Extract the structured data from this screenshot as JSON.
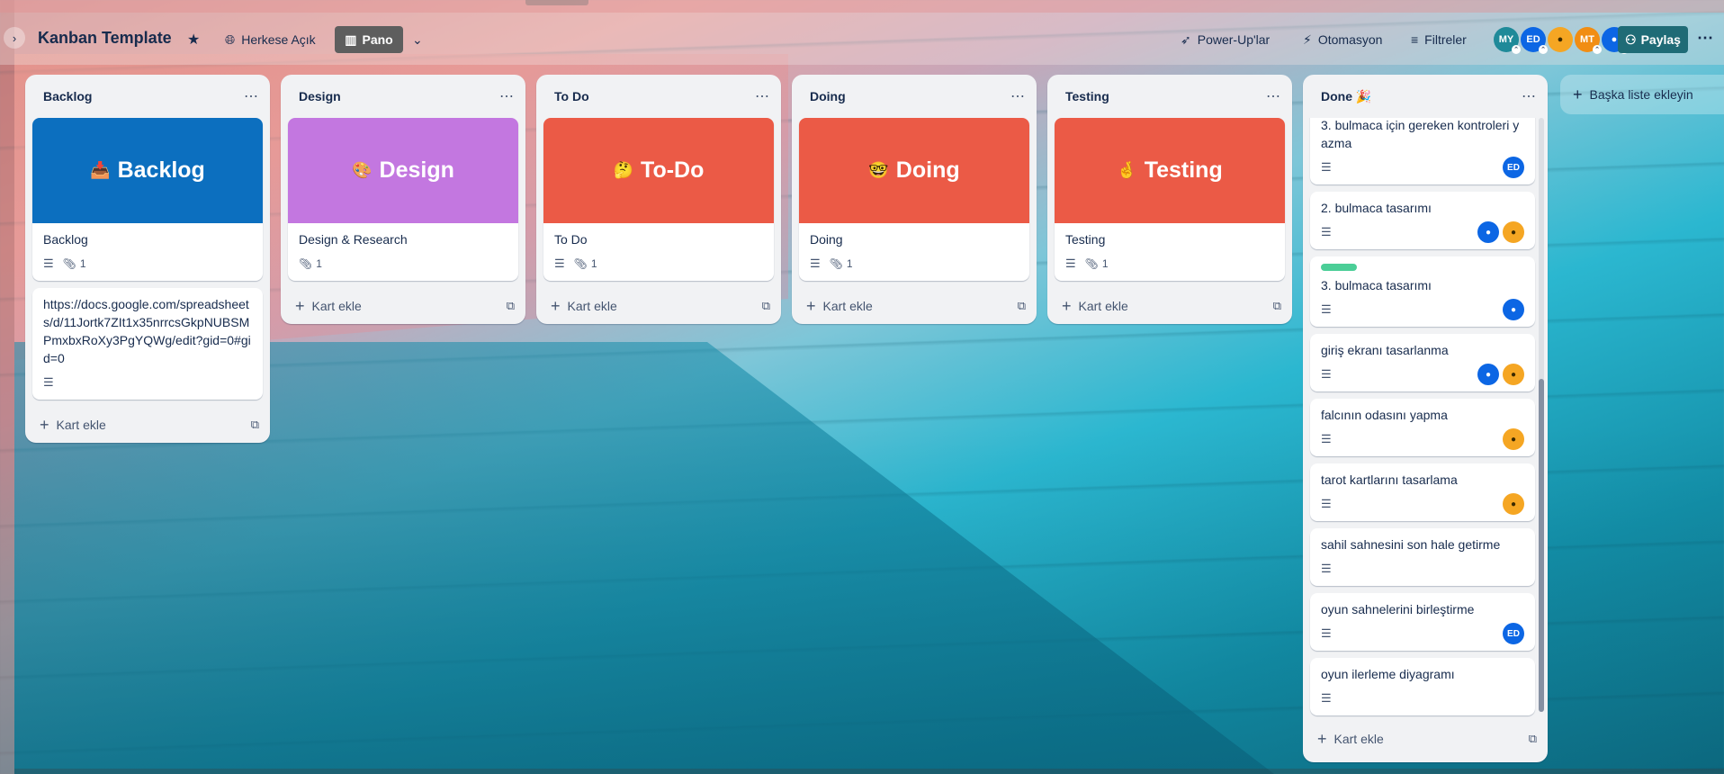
{
  "header": {
    "board_title": "Kanban Template",
    "visibility_label": "Herkese Açık",
    "view_label": "Pano",
    "powerups_label": "Power-Up'lar",
    "automation_label": "Otomasyon",
    "filters_label": "Filtreler",
    "share_label": "Paylaş",
    "avatars": [
      {
        "initials": "MY",
        "color": "#1f8a99"
      },
      {
        "initials": "ED",
        "color": "#0c66e4"
      },
      {
        "initials": "",
        "color": "#f5a623"
      },
      {
        "initials": "MT",
        "color": "#f18d13"
      },
      {
        "initials": "",
        "color": "#0c66e4"
      }
    ]
  },
  "lists": [
    {
      "title": "Backlog",
      "cover": {
        "emoji": "📥",
        "text": "Backlog",
        "color": "#0c6fbf"
      },
      "cover_card": {
        "title": "Backlog",
        "attachments": "1"
      },
      "extra_card": {
        "title": "https://docs.google.com/spreadsheets/d/11Jortk7ZIt1x35nrrcsGkpNUBSMPmxbxRoXy3PgYQWg/edit?gid=0#gid=0"
      },
      "add_card": "Kart ekle"
    },
    {
      "title": "Design",
      "cover": {
        "emoji": "🎨",
        "text": "Design",
        "color": "#c377e0"
      },
      "cover_card": {
        "title": "Design & Research",
        "attachments": "1"
      },
      "add_card": "Kart ekle"
    },
    {
      "title": "To Do",
      "cover": {
        "emoji": "🤔",
        "text": "To-Do",
        "color": "#eb5a46"
      },
      "cover_card": {
        "title": "To Do",
        "attachments": "1"
      },
      "add_card": "Kart ekle"
    },
    {
      "title": "Doing",
      "cover": {
        "emoji": "🤓",
        "text": "Doing",
        "color": "#eb5a46"
      },
      "cover_card": {
        "title": "Doing",
        "attachments": "1"
      },
      "add_card": "Kart ekle"
    },
    {
      "title": "Testing",
      "cover": {
        "emoji": "🤞",
        "text": "Testing",
        "color": "#eb5a46"
      },
      "cover_card": {
        "title": "Testing",
        "attachments": "1"
      },
      "add_card": "Kart ekle"
    }
  ],
  "done": {
    "title": "Done 🎉",
    "cards": [
      {
        "title": "3. bulmaca için gereken kontroleri yazma",
        "members": [
          "ED"
        ]
      },
      {
        "title": "2. bulmaca tasarımı",
        "members": [
          "blue",
          "orange"
        ]
      },
      {
        "title": "3. bulmaca tasarımı",
        "members": [
          "blue"
        ],
        "label": "green"
      },
      {
        "title": "giriş ekranı tasarlanma",
        "members": [
          "blue",
          "orange"
        ]
      },
      {
        "title": "falcının odasını yapma",
        "members": [
          "orange"
        ]
      },
      {
        "title": "tarot kartlarını tasarlama",
        "members": [
          "orange"
        ]
      },
      {
        "title": "sahil sahnesini son hale getirme",
        "members": []
      },
      {
        "title": "oyun sahnelerini birleştirme",
        "members": [
          "ED"
        ]
      },
      {
        "title": "oyun ilerleme diyagramı",
        "members": []
      }
    ],
    "add_card": "Kart ekle"
  },
  "add_list_label": "Başka liste ekleyin"
}
